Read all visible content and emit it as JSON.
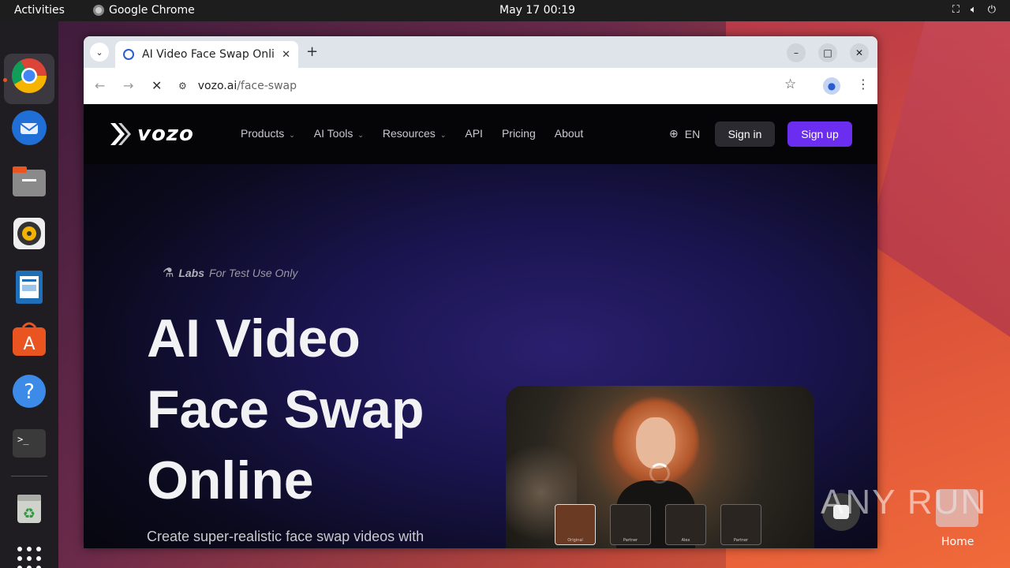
{
  "topbar": {
    "activities": "Activities",
    "app_name": "Google Chrome",
    "clock": "May 17  00:19",
    "tray_icons": [
      "network-icon",
      "volume-icon",
      "power-icon"
    ]
  },
  "dock": {
    "items": [
      "chrome",
      "thunderbird",
      "files",
      "rhythmbox",
      "libreoffice-writer",
      "app-center",
      "help",
      "terminal",
      "trash",
      "show-apps"
    ]
  },
  "browser": {
    "tab_title": "AI Video Face Swap Onli",
    "url_host": "vozo.ai",
    "url_path": "/face-swap"
  },
  "site": {
    "logo": "vozo",
    "menu": [
      {
        "label": "Products",
        "dropdown": true
      },
      {
        "label": "AI Tools",
        "dropdown": true
      },
      {
        "label": "Resources",
        "dropdown": true
      },
      {
        "label": "API",
        "dropdown": false
      },
      {
        "label": "Pricing",
        "dropdown": false
      },
      {
        "label": "About",
        "dropdown": false
      }
    ],
    "lang": "EN",
    "signin": "Sign in",
    "signup": "Sign up",
    "labs_word": "Labs",
    "labs_note": "For Test Use Only",
    "headline_1": "AI Video",
    "headline_2": "Face Swap",
    "headline_3": "Online",
    "subtitle": "Create super-realistic face swap videos with",
    "thumb_labels": [
      "Original",
      "Partner",
      "Alex",
      "Partner"
    ]
  },
  "overlay": {
    "watermark": "ANY RUN",
    "home_label": "Home"
  },
  "colors": {
    "accent": "#6b2ef0",
    "topbar": "#1d1d1d",
    "dock": "#1f1c22"
  }
}
